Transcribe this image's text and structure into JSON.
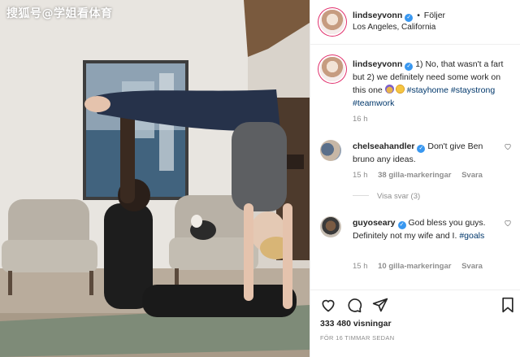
{
  "watermark": "搜狐号@学姐看体育",
  "post": {
    "username": "lindseyvonn",
    "dot": "•",
    "follow_label": "Följer",
    "location": "Los Angeles, California",
    "verified_icon": "verified-badge-icon",
    "caption_text": "1) No, that wasn't a fart but 2) we definitely need some work on this one",
    "caption_tags": [
      "#stayhome",
      "#staystrong",
      "#teamwork"
    ],
    "caption_time": "16 h"
  },
  "comments": [
    {
      "username": "chelseahandler",
      "text": "Don't give Ben bruno any ideas.",
      "time": "15 h",
      "likes": "38 gilla-markeringar",
      "reply_label": "Svara",
      "replies_label": "Visa svar (3)"
    },
    {
      "username": "guyoseary",
      "text": "God bless you guys. Definitely not my wife and I.",
      "tag": "#goals",
      "time": "15 h",
      "likes": "10 gilla-markeringar",
      "reply_label": "Svara"
    }
  ],
  "actions": {
    "views": "333 480 visningar",
    "posted_ago": "FÖR 16 TIMMAR SEDAN"
  },
  "colors": {
    "link": "#00376b",
    "verified": "#3897f0",
    "muted": "#8e8e8e",
    "story_ring": "#e1306c"
  }
}
